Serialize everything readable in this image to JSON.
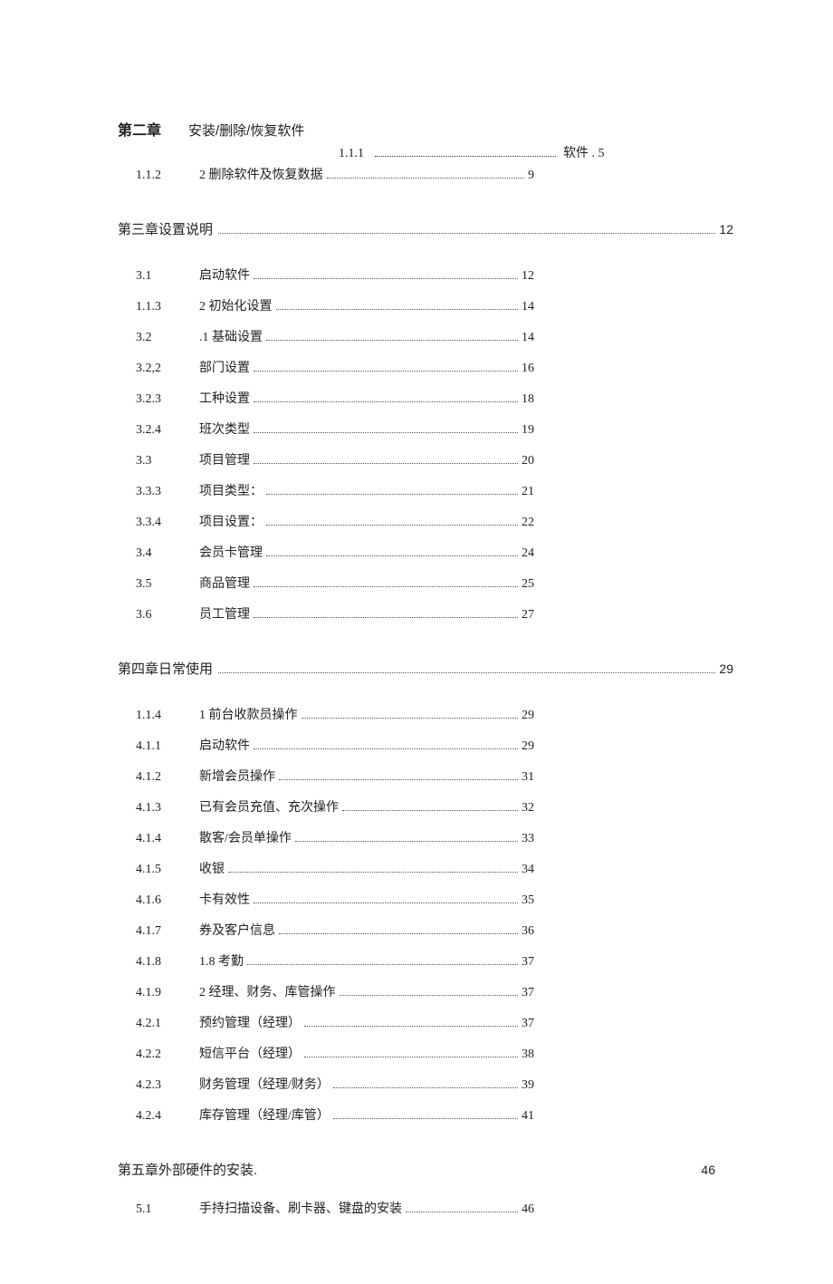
{
  "ch2": {
    "bold": "第二章",
    "title": "安装/删除/恢复软件",
    "line111_num": "1.1.1",
    "line111_tail": "软件 . 5",
    "line112_num": "1.1.2",
    "line112_label": "2 删除软件及恢复数据",
    "line112_page": "9"
  },
  "ch3": {
    "title": "第三章设置说明",
    "page": "12",
    "items": [
      {
        "num": "3.1",
        "label": "启动软件",
        "page": "12"
      },
      {
        "num": "1.1.3",
        "label": "2 初始化设置",
        "page": "14"
      },
      {
        "num": "3.2",
        "label": ".1 基础设置",
        "page": "14"
      },
      {
        "num": "3.2,2",
        "label": "部门设置",
        "page": "16"
      },
      {
        "num": "3.2.3",
        "label": "工种设置",
        "page": "18"
      },
      {
        "num": "3.2.4",
        "label": "班次类型",
        "page": "19"
      },
      {
        "num": "3.3",
        "label": "项目管理",
        "page": "20"
      },
      {
        "num": "3.3.3",
        "label": "项目类型：",
        "page": "21"
      },
      {
        "num": "3.3.4",
        "label": "项目设置：",
        "page": "22"
      },
      {
        "num": "3.4",
        "label": "会员卡管理",
        "page": "24"
      },
      {
        "num": "3.5",
        "label": "商品管理",
        "page": "25"
      },
      {
        "num": "3.6",
        "label": "员工管理",
        "page": "27"
      }
    ]
  },
  "ch4": {
    "title": "第四章日常使用",
    "page": "29",
    "items": [
      {
        "num": "1.1.4",
        "label": "1 前台收款员操作",
        "page": "29"
      },
      {
        "num": "4.1.1",
        "label": "启动软件",
        "page": "29"
      },
      {
        "num": "4.1.2",
        "label": "新增会员操作",
        "page": "31"
      },
      {
        "num": "4.1.3",
        "label": "已有会员充值、充次操作",
        "page": "32"
      },
      {
        "num": "4.1.4",
        "label": "散客/会员单操作",
        "page": "33"
      },
      {
        "num": "4.1.5",
        "label": "收银",
        "page": "34"
      },
      {
        "num": "4.1.6",
        "label": "卡有效性",
        "page": "35"
      },
      {
        "num": "4.1.7",
        "label": "券及客户信息",
        "page": "36"
      },
      {
        "num": "4.1.8",
        "label": "1.8 考勤",
        "page": "37"
      },
      {
        "num": "4.1.9",
        "label": "2 经理、财务、库管操作",
        "page": "37"
      },
      {
        "num": "4.2.1",
        "label": "预约管理（经理）",
        "page": "37"
      },
      {
        "num": "4.2.2",
        "label": "短信平台（经理）",
        "page": "38"
      },
      {
        "num": "4.2.3",
        "label": "财务管理（经理/财务）",
        "page": "39"
      },
      {
        "num": "4.2.4",
        "label": "库存管理（经理/库管）",
        "page": "41"
      }
    ]
  },
  "ch5": {
    "title": "第五章外部硬件的安装.",
    "page": "46",
    "items": [
      {
        "num": "5.1",
        "label": "手持扫描设备、刷卡器、键盘的安装",
        "page": "46"
      }
    ]
  }
}
